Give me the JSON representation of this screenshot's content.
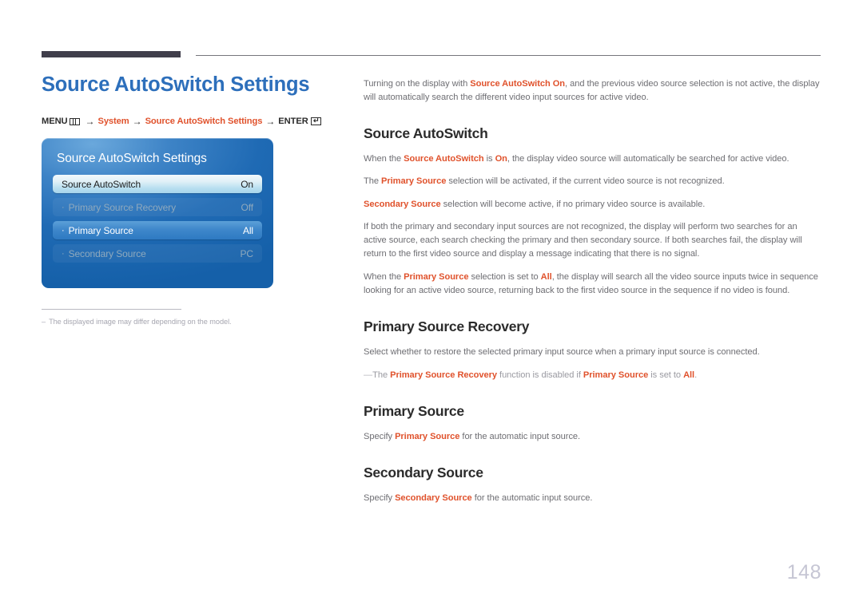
{
  "page": {
    "title": "Source AutoSwitch Settings",
    "number": "148"
  },
  "menu_path": {
    "menu_label": "MENU",
    "menu_icon": "menu-bars-icon",
    "arrow1": "→",
    "system": "System",
    "arrow2": "→",
    "settings": "Source AutoSwitch Settings",
    "arrow3": "→",
    "enter_label": "ENTER",
    "enter_icon": "enter-return-icon",
    "enter_glyph": "↵"
  },
  "osd": {
    "title": "Source AutoSwitch Settings",
    "rows": [
      {
        "bullet": "",
        "label": "Source AutoSwitch",
        "value": "On",
        "state": "selected"
      },
      {
        "bullet": "·",
        "label": "Primary Source Recovery",
        "value": "Off",
        "state": "disabled"
      },
      {
        "bullet": "·",
        "label": "Primary Source",
        "value": "All",
        "state": "highlight"
      },
      {
        "bullet": "·",
        "label": "Secondary Source",
        "value": "PC",
        "state": "disabled"
      }
    ]
  },
  "caption": {
    "dash": "–",
    "text": "The displayed image may differ depending on the model."
  },
  "intro": {
    "part1": "Turning on the display with ",
    "accent1": "Source AutoSwitch On",
    "part2": ", and the previous video source selection is not active, the display will automatically search the different video input sources for active video."
  },
  "sections": [
    {
      "title": "Source AutoSwitch",
      "paragraphs": [
        {
          "segments": [
            {
              "t": "When the ",
              "a": false
            },
            {
              "t": "Source AutoSwitch",
              "a": true
            },
            {
              "t": " is ",
              "a": false
            },
            {
              "t": "On",
              "a": true
            },
            {
              "t": ", the display video source will automatically be searched for active video.",
              "a": false
            }
          ]
        },
        {
          "segments": [
            {
              "t": "The ",
              "a": false
            },
            {
              "t": "Primary Source",
              "a": true
            },
            {
              "t": " selection will be activated, if the current video source is not recognized.",
              "a": false
            }
          ]
        },
        {
          "segments": [
            {
              "t": "Secondary Source",
              "a": true
            },
            {
              "t": " selection will become active, if no primary video source is available.",
              "a": false
            }
          ]
        },
        {
          "segments": [
            {
              "t": "If both the primary and secondary input sources are not recognized, the display will perform two searches for an active source, each search checking the primary and then secondary source. If both searches fail, the display will return to the first video source and display a message indicating that there is no signal.",
              "a": false
            }
          ]
        },
        {
          "segments": [
            {
              "t": "When the ",
              "a": false
            },
            {
              "t": "Primary Source",
              "a": true
            },
            {
              "t": " selection is set to ",
              "a": false
            },
            {
              "t": "All",
              "a": true
            },
            {
              "t": ", the display will search all the video source inputs twice in sequence looking for an active video source, returning back to the first video source in the sequence if no video is found.",
              "a": false
            }
          ]
        }
      ]
    },
    {
      "title": "Primary Source Recovery",
      "paragraphs": [
        {
          "segments": [
            {
              "t": "Select whether to restore the selected primary input source when a primary input source is connected.",
              "a": false
            }
          ]
        }
      ],
      "note": {
        "dash": "―",
        "segments": [
          {
            "t": "The ",
            "a": false
          },
          {
            "t": "Primary Source Recovery",
            "a": true
          },
          {
            "t": " function is disabled if ",
            "a": false
          },
          {
            "t": "Primary Source",
            "a": true
          },
          {
            "t": " is set to ",
            "a": false
          },
          {
            "t": "All",
            "a": true
          },
          {
            "t": ".",
            "a": false
          }
        ]
      }
    },
    {
      "title": "Primary Source",
      "paragraphs": [
        {
          "segments": [
            {
              "t": "Specify ",
              "a": false
            },
            {
              "t": "Primary Source",
              "a": true
            },
            {
              "t": " for the automatic input source.",
              "a": false
            }
          ]
        }
      ]
    },
    {
      "title": "Secondary Source",
      "paragraphs": [
        {
          "segments": [
            {
              "t": "Specify ",
              "a": false
            },
            {
              "t": "Secondary Source",
              "a": true
            },
            {
              "t": " for the automatic input source.",
              "a": false
            }
          ]
        }
      ]
    }
  ],
  "colors": {
    "title_blue": "#2d6fbb",
    "accent_orange": "#e0522c",
    "body_gray": "#6e6e73",
    "rule_dark": "#403e4b",
    "osd_blue": "#1f6ab4",
    "page_number": "#c6c6d4"
  }
}
